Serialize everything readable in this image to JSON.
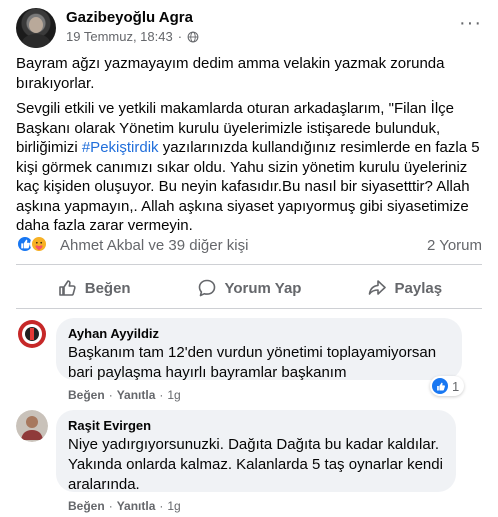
{
  "post": {
    "author": "Gazibeyoğlu Agra",
    "date": "19 Temmuz, 18:43",
    "dot": "·",
    "more_label": "···",
    "paragraph1": "Bayram ağzı yazmayayım dedim amma velakin yazmak zorunda bırakıyorlar.",
    "paragraph2_before": "Sevgili etkili ve yetkili makamlarda oturan arkadaşlarım, \"Filan İlçe Başkanı olarak Yönetim kurulu üyelerimizle istişarede bulunduk, birliğimizi ",
    "hashtag": "#Pekiştirdik",
    "paragraph2_after": " yazılarınızda kullandığınız resimlerde en fazla 5 kişi görmek canımızı sıkar oldu. Yahu sizin yönetim kurulu üyeleriniz kaç kişiden oluşuyor. Bu neyin kafasıdır.Bu nasıl bir siyasetttir? Allah aşkına yapmayın,. Allah aşkına siyaset yapıyormuş gibi siyasetimize daha  fazla zarar vermeyin."
  },
  "reactions": {
    "summary": "Ahmet Akbal ve 39 diğer kişi",
    "comments_count": "2 Yorum"
  },
  "actions": {
    "like": "Beğen",
    "comment": "Yorum Yap",
    "share": "Paylaş"
  },
  "comments": [
    {
      "name": "Ayhan Ayyildiz",
      "text": "Başkanım tam 12'den vurdun yönetimi toplayamiyorsan bari paylaşma hayırlı bayramlar başkanım",
      "like": "Beğen",
      "sep": "·",
      "reply": "Yanıtla",
      "time": "1g",
      "reaction_count": "1"
    },
    {
      "name": "Raşit Evirgen",
      "text": "Niye yadırgıyorsunuzki. Dağıta Dağıta bu kadar kaldılar. Yakında onlarda kalmaz. Kalanlarda 5 taş oynarlar kendi aralarında.",
      "like": "Beğen",
      "sep": "·",
      "reply": "Yanıtla",
      "time": "1g"
    }
  ],
  "colors": {
    "link_blue": "#216fdb",
    "like_blue": "#1877f2",
    "muted_gray": "#65676b",
    "bubble_gray": "#f0f2f5"
  },
  "icons": [
    "globe-icon",
    "more-icon",
    "like-reaction-icon",
    "care-reaction-icon",
    "thumbs-up-icon",
    "comment-icon",
    "share-icon"
  ]
}
